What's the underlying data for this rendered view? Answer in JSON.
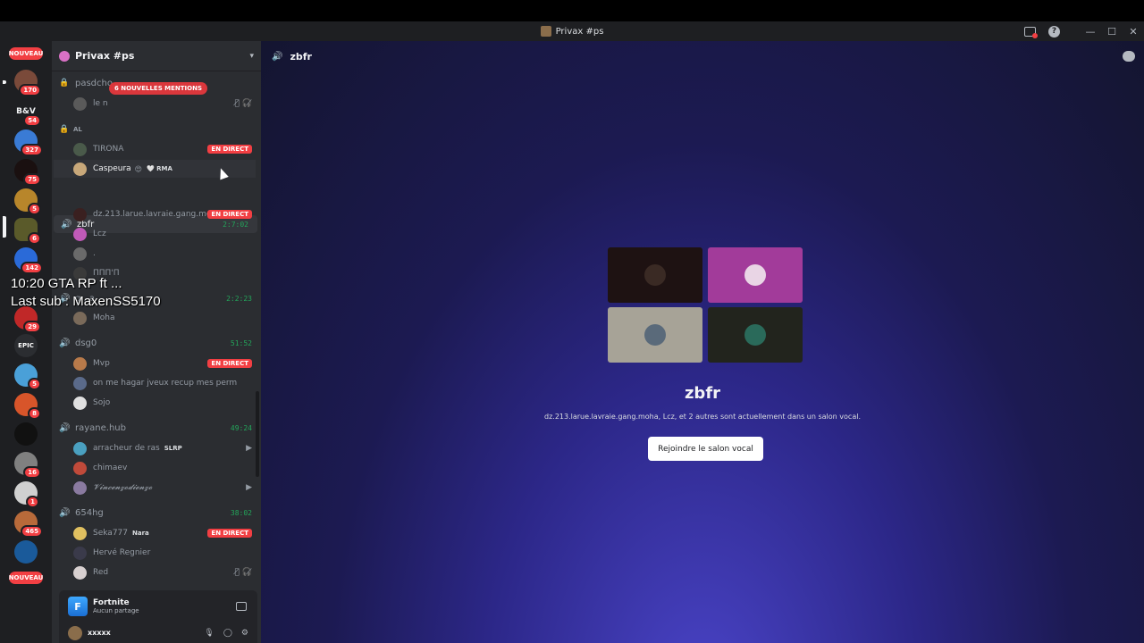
{
  "window": {
    "title": "Privax #ps"
  },
  "guild_bar": {
    "new_top": "NOUVEAU",
    "new_bottom": "NOUVEAU",
    "server_text": "B&V",
    "badges": [
      "170",
      "54",
      "327",
      "75",
      "5",
      "6",
      "142",
      "29",
      "5",
      "8",
      "16",
      "1",
      "465"
    ],
    "epic_label": "EPIC"
  },
  "server": {
    "name": "Privax #ps"
  },
  "mentions_label": "6 NOUVELLES MENTIONS",
  "channels": {
    "pasdchoix": {
      "name": "pasdcho",
      "users": [
        {
          "name": "le n"
        }
      ]
    },
    "category_al": "AL",
    "al_users": [
      {
        "name": "TIRONA",
        "live": "EN DIRECT"
      },
      {
        "name": "Caspeura",
        "emoji": "😍",
        "tag": "🤍 RMA"
      }
    ],
    "zbfr": {
      "name": "zbfr",
      "timer": "2:7:02",
      "users": [
        {
          "name": "dz.213.larue.lavraie.gang.moha",
          "live": "EN DIRECT"
        },
        {
          "name": "Lcz"
        },
        {
          "name": "."
        },
        {
          "name": "ΠΠΠ'Π"
        }
      ]
    },
    "hidden_vc": {
      "name": "g...a",
      "timer": "2:2:23",
      "users": [
        {
          "name": "Moha"
        }
      ]
    },
    "dsg0": {
      "name": "dsg0",
      "timer": "51:52",
      "users": [
        {
          "name": "Mvp",
          "live": "EN DIRECT"
        },
        {
          "name": "on me hagar jveux recup mes perm"
        },
        {
          "name": "Sojo"
        }
      ]
    },
    "rayane": {
      "name": "rayane.hub",
      "timer": "49:24",
      "users": [
        {
          "name": "arracheur de ras",
          "tag": "SLRP"
        },
        {
          "name": "chimaev"
        },
        {
          "name": "𝓥𝓲𝓷𝓬𝓮𝓷𝔃𝓸𝓭𝓲𝓮𝓷𝔃𝓸"
        }
      ]
    },
    "h654": {
      "name": "654hg",
      "timer": "38:02",
      "users": [
        {
          "name": "Seka777",
          "tag": "Nara",
          "live": "EN DIRECT"
        },
        {
          "name": "Hervé Regnier"
        },
        {
          "name": "Red"
        }
      ]
    }
  },
  "activity": {
    "title": "Fortnite",
    "subtitle": "Aucun partage"
  },
  "user_panel": {
    "name": "xxxxx"
  },
  "main": {
    "channel_name": "zbfr",
    "title": "zbfr",
    "description": "dz.213.larue.lavraie.gang.moha, Lcz, et 2 autres sont actuellement dans un salon vocal.",
    "join_label": "Rejoindre le salon vocal"
  },
  "stream_overlay": {
    "line1": "10:20 GTA RP ft ...",
    "line2": "Last sub : MaxenSS5170"
  },
  "colors": {
    "accent_green": "#23a55a",
    "live_red": "#f23f43",
    "tile_pink": "#a23b9a",
    "tile_grey": "#a7a397",
    "tile_dark": "#1e1212"
  }
}
